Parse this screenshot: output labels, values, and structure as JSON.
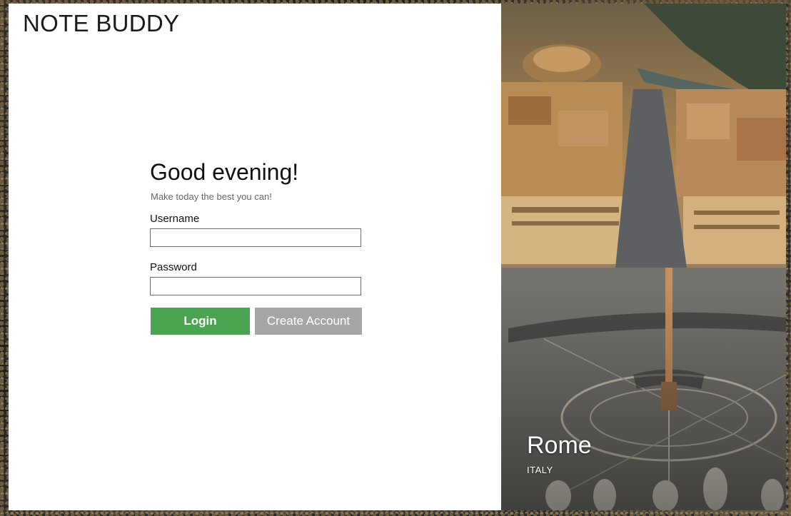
{
  "app": {
    "brand": "NOTE BUDDY"
  },
  "login": {
    "greeting": "Good evening!",
    "subtitle": "Make today the best you can!",
    "username_label": "Username",
    "username_value": "",
    "password_label": "Password",
    "password_value": "",
    "login_button": "Login",
    "create_account_button": "Create Account"
  },
  "location": {
    "city": "Rome",
    "country": "ITALY"
  },
  "colors": {
    "login_button": "#4aa452",
    "create_account_button": "#a6a6a6"
  },
  "icons": {
    "background_photo": "rome-aerial-photo"
  }
}
